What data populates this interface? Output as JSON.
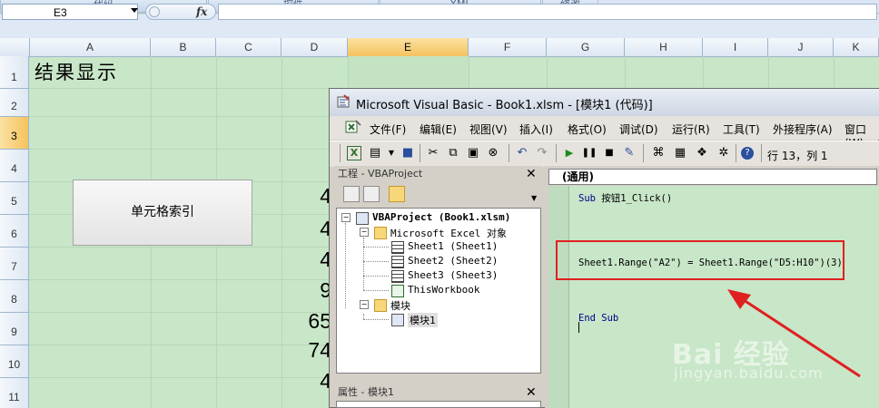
{
  "ribbon": {
    "groups": [
      "代码",
      "控件",
      "XML",
      "修改"
    ]
  },
  "formula_bar": {
    "name_box": "E3",
    "fx_label": "fx",
    "formula": ""
  },
  "sheet": {
    "columns": [
      "A",
      "B",
      "C",
      "D",
      "E",
      "F",
      "G",
      "H",
      "I",
      "J",
      "K"
    ],
    "selected_column": "E",
    "rows": [
      "1",
      "2",
      "3",
      "4",
      "5",
      "6",
      "7",
      "8",
      "9",
      "10",
      "11"
    ],
    "selected_row": "3",
    "title_cell": "结果显示",
    "button_label": "单元格索引",
    "d_column_values": [
      "4",
      "4",
      "4",
      "9",
      "65",
      "74",
      "4"
    ]
  },
  "vbe": {
    "title": "Microsoft Visual Basic - Book1.xlsm - [模块1 (代码)]",
    "menu": [
      "文件(F)",
      "编辑(E)",
      "视图(V)",
      "插入(I)",
      "格式(O)",
      "调试(D)",
      "运行(R)",
      "工具(T)",
      "外接程序(A)",
      "窗口(W)"
    ],
    "cursor_position": "行 13，列 1",
    "project_panel_title": "工程 - VBAProject",
    "project_tree": {
      "root": "VBAProject (Book1.xlsm)",
      "excel_objects": "Microsoft Excel 对象",
      "sheets": [
        "Sheet1 (Sheet1)",
        "Sheet2 (Sheet2)",
        "Sheet3 (Sheet3)",
        "ThisWorkbook"
      ],
      "modules_folder": "模块",
      "module": "模块1"
    },
    "properties_title": "属性 - 模块1",
    "code_object": "(通用)",
    "code_lines": {
      "sub_line_kw": "Sub",
      "sub_line_name": " 按钮1_Click()",
      "statement": "Sheet1.Range(\"A2\") = Sheet1.Range(\"D5:H10\")(3)",
      "end_sub": "End Sub"
    }
  },
  "watermark": {
    "brand": "Bai 经验",
    "url": "jingyan.baidu.com"
  },
  "colors": {
    "sheet_bg": "#c8e6c8",
    "highlight_box": "#e02020",
    "keyword": "#00008b",
    "selected_header": "#f5c25d"
  }
}
